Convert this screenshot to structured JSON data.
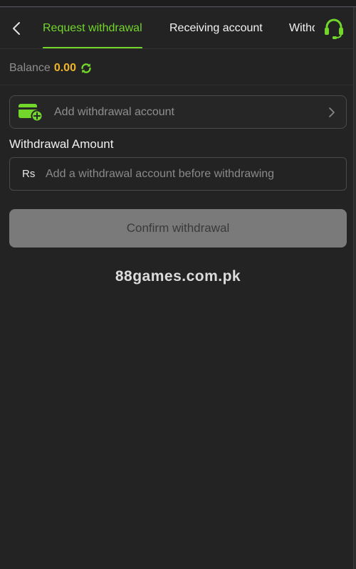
{
  "header": {
    "back_icon": "chevron-left-icon",
    "tabs": [
      {
        "label": "Request withdrawal",
        "active": true
      },
      {
        "label": "Receiving account",
        "active": false
      },
      {
        "label": "Withdrawal record",
        "active": false
      }
    ],
    "support_icon": "headset-icon"
  },
  "balance": {
    "label": "Balance",
    "value": "0.00",
    "refresh_icon": "refresh-icon"
  },
  "account": {
    "icon": "wallet-add-icon",
    "label": "Add withdrawal account"
  },
  "amount": {
    "label": "Withdrawal Amount",
    "currency": "Rs",
    "placeholder": "Add a withdrawal account before withdrawing",
    "value": ""
  },
  "confirm": {
    "label": "Confirm withdrawal",
    "enabled": false
  },
  "watermark": "88games.com.pk",
  "colors": {
    "accent": "#72d62b",
    "balance": "#f0b429",
    "background": "#232323",
    "button_disabled": "#7a7a7a"
  }
}
